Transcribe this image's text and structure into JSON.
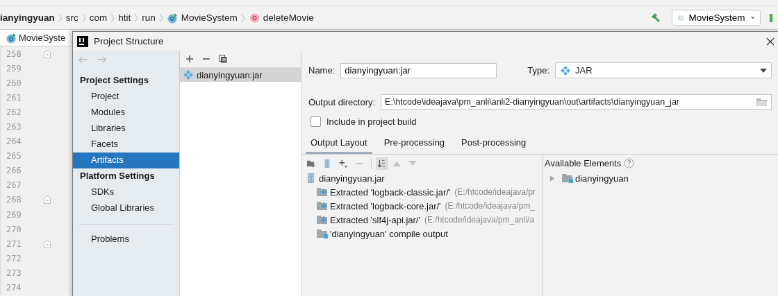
{
  "breadcrumb": [
    {
      "label": "ianyingyuan",
      "kind": "project"
    },
    {
      "label": "src",
      "kind": "folder"
    },
    {
      "label": "com",
      "kind": "folder"
    },
    {
      "label": "htit",
      "kind": "folder"
    },
    {
      "label": "run",
      "kind": "folder"
    },
    {
      "label": "MovieSystem",
      "kind": "class"
    },
    {
      "label": "deleteMovie",
      "kind": "method"
    }
  ],
  "run_config": "MovieSystem",
  "editor_tab": {
    "label": "MovieSyste"
  },
  "lines": [
    {
      "n": "258",
      "fold": true
    },
    {
      "n": "259",
      "fold": false
    },
    {
      "n": "260",
      "fold": false
    },
    {
      "n": "261",
      "fold": false
    },
    {
      "n": "262",
      "fold": false
    },
    {
      "n": "263",
      "fold": false
    },
    {
      "n": "264",
      "fold": false
    },
    {
      "n": "265",
      "fold": false
    },
    {
      "n": "266",
      "fold": false
    },
    {
      "n": "267",
      "fold": false
    },
    {
      "n": "268",
      "fold": true
    },
    {
      "n": "269",
      "fold": false
    },
    {
      "n": "270",
      "fold": false
    },
    {
      "n": "271",
      "fold": true
    },
    {
      "n": "272",
      "fold": false
    },
    {
      "n": "273",
      "fold": false
    },
    {
      "n": "274",
      "fold": false
    }
  ],
  "dialog": {
    "title": "Project Structure",
    "nav": [
      {
        "kind": "header",
        "label": "Project Settings"
      },
      {
        "kind": "item",
        "label": "Project",
        "selected": false
      },
      {
        "kind": "item",
        "label": "Modules",
        "selected": false
      },
      {
        "kind": "item",
        "label": "Libraries",
        "selected": false
      },
      {
        "kind": "item",
        "label": "Facets",
        "selected": false
      },
      {
        "kind": "item",
        "label": "Artifacts",
        "selected": true
      },
      {
        "kind": "header",
        "label": "Platform Settings"
      },
      {
        "kind": "item",
        "label": "SDKs",
        "selected": false
      },
      {
        "kind": "item",
        "label": "Global Libraries",
        "selected": false
      },
      {
        "kind": "separator"
      },
      {
        "kind": "item",
        "label": "Problems",
        "selected": false
      }
    ],
    "artifacts": [
      {
        "label": "dianyingyuan:jar",
        "selected": true
      }
    ],
    "name_label": "Name:",
    "name_value": "dianyingyuan:jar",
    "type_label": "Type:",
    "type_value": "JAR",
    "output_label": "Output directory:",
    "output_value": "E:\\htcode\\ideajava\\pm_anli\\anli2-dianyingyuan\\out\\artifacts\\dianyingyuan_jar",
    "include_label": "Include in project build",
    "include_checked": false,
    "tabs": [
      {
        "label": "Output Layout",
        "selected": true
      },
      {
        "label": "Pre-processing",
        "selected": false
      },
      {
        "label": "Post-processing",
        "selected": false
      }
    ],
    "layout_tree": [
      {
        "kind": "jar",
        "label": "dianyingyuan.jar",
        "children": [
          {
            "kind": "extracted",
            "label": "Extracted 'logback-classic.jar/'",
            "detail": "(E:/htcode/ideajava/pr"
          },
          {
            "kind": "extracted",
            "label": "Extracted 'logback-core.jar/'",
            "detail": "(E:/htcode/ideajava/pm_"
          },
          {
            "kind": "extracted",
            "label": "Extracted 'slf4j-api.jar/'",
            "detail": "(E:/htcode/ideajava/pm_anli/a"
          },
          {
            "kind": "module_output",
            "label": "'dianyingyuan' compile output"
          }
        ]
      }
    ],
    "available_label": "Available Elements",
    "available": [
      {
        "kind": "module",
        "label": "dianyingyuan",
        "expanded": false
      }
    ]
  }
}
